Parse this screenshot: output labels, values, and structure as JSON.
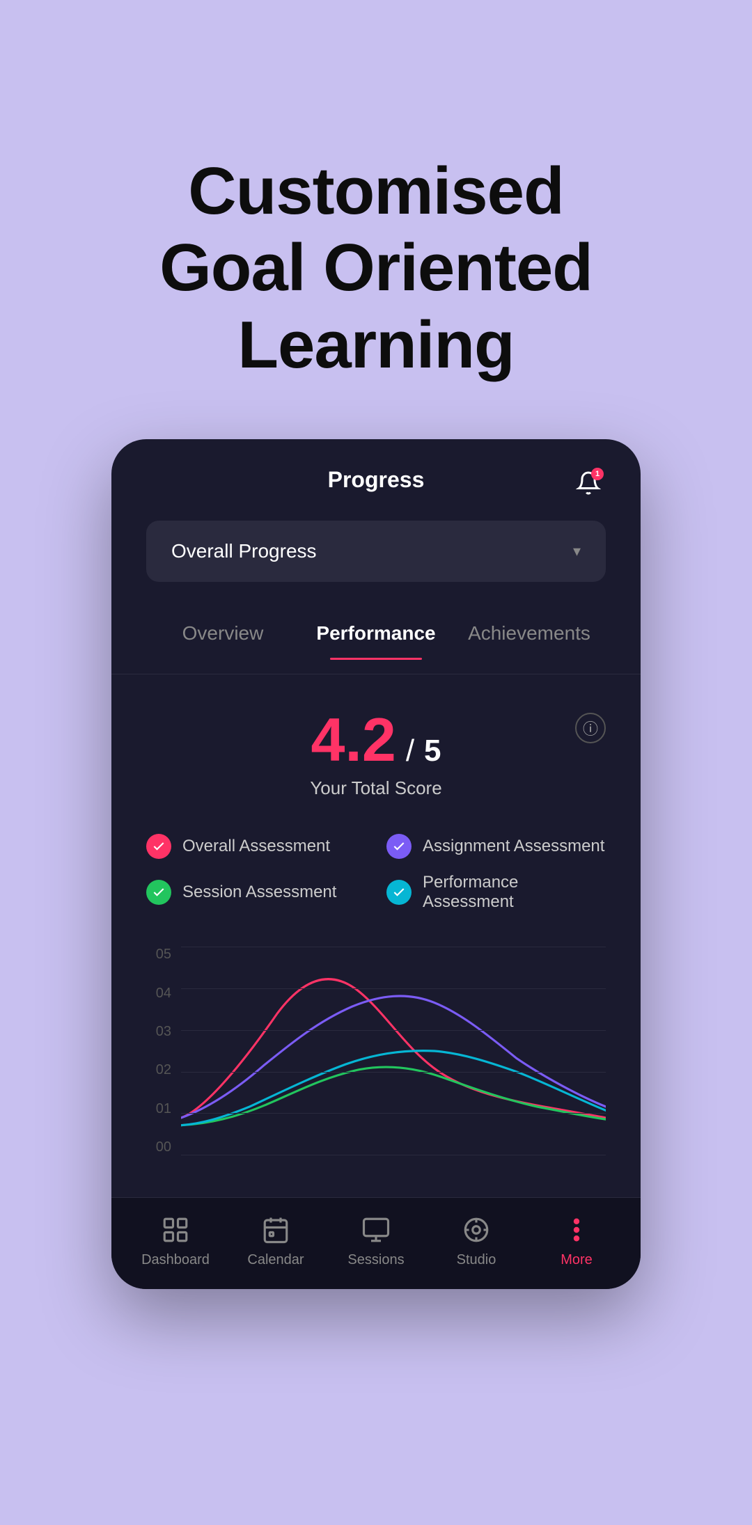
{
  "hero": {
    "title_line1": "Customised",
    "title_line2": "Goal Oriented Learning"
  },
  "app": {
    "header": {
      "title": "Progress",
      "notification_count": "1"
    },
    "dropdown": {
      "label": "Overall Progress",
      "placeholder": "Overall Progress"
    },
    "tabs": [
      {
        "id": "overview",
        "label": "Overview",
        "active": false
      },
      {
        "id": "performance",
        "label": "Performance",
        "active": true
      },
      {
        "id": "achievements",
        "label": "Achievements",
        "active": false
      }
    ],
    "score": {
      "value": "4.2",
      "max": "5",
      "label": "Your Total Score"
    },
    "legend": [
      {
        "id": "overall",
        "label": "Overall Assessment",
        "color": "pink"
      },
      {
        "id": "assignment",
        "label": "Assignment Assessment",
        "color": "purple"
      },
      {
        "id": "session",
        "label": "Session Assessment",
        "color": "green"
      },
      {
        "id": "performance",
        "label": "Performance Assessment",
        "color": "cyan"
      }
    ],
    "chart": {
      "y_labels": [
        "00",
        "01",
        "02",
        "03",
        "04",
        "05"
      ]
    },
    "bottom_nav": [
      {
        "id": "dashboard",
        "label": "Dashboard",
        "icon": "dashboard"
      },
      {
        "id": "calendar",
        "label": "Calendar",
        "icon": "calendar"
      },
      {
        "id": "sessions",
        "label": "Sessions",
        "icon": "sessions"
      },
      {
        "id": "studio",
        "label": "Studio",
        "icon": "studio"
      },
      {
        "id": "more",
        "label": "More",
        "icon": "more",
        "active": true
      }
    ]
  }
}
